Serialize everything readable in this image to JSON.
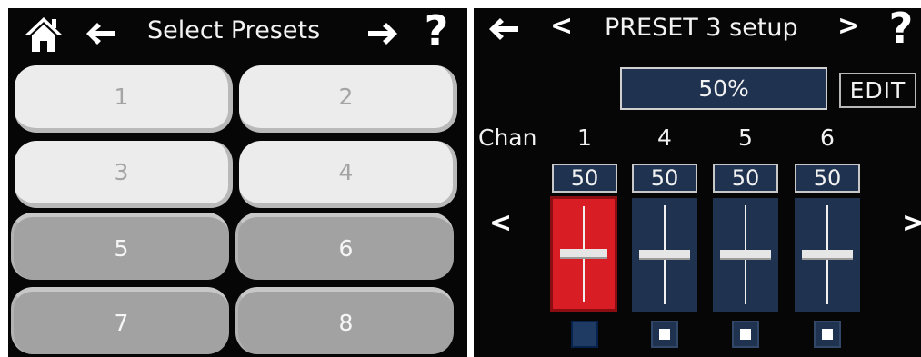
{
  "left": {
    "title": "Select Presets",
    "home_icon": "home-icon",
    "back_icon": "arrow-left-icon",
    "forward_icon": "arrow-right-icon",
    "help_label": "?",
    "presets": [
      {
        "label": "1",
        "state": "available"
      },
      {
        "label": "2",
        "state": "available"
      },
      {
        "label": "3",
        "state": "available"
      },
      {
        "label": "4",
        "state": "available"
      },
      {
        "label": "5",
        "state": "selected"
      },
      {
        "label": "6",
        "state": "selected"
      },
      {
        "label": "7",
        "state": "selected"
      },
      {
        "label": "8",
        "state": "selected"
      }
    ]
  },
  "right": {
    "back_icon": "arrow-left-icon",
    "prev_label": "<",
    "title": "PRESET 3 setup",
    "next_label": ">",
    "help_label": "?",
    "level_display": "50%",
    "edit_label": "EDIT",
    "chan_label": "Chan",
    "scroll_left_label": "<",
    "scroll_right_label": ">",
    "channels": [
      {
        "number": "1",
        "value": "50",
        "level": 0.5,
        "active": true,
        "checked": false
      },
      {
        "number": "4",
        "value": "50",
        "level": 0.5,
        "active": false,
        "checked": true
      },
      {
        "number": "5",
        "value": "50",
        "level": 0.5,
        "active": false,
        "checked": true
      },
      {
        "number": "6",
        "value": "50",
        "level": 0.5,
        "active": false,
        "checked": true
      }
    ]
  },
  "colors": {
    "background": "#060606",
    "panel_blue": "#1f3350",
    "active_red": "#d81e24",
    "button_light": "#ececec",
    "button_dark": "#a2a2a2"
  }
}
